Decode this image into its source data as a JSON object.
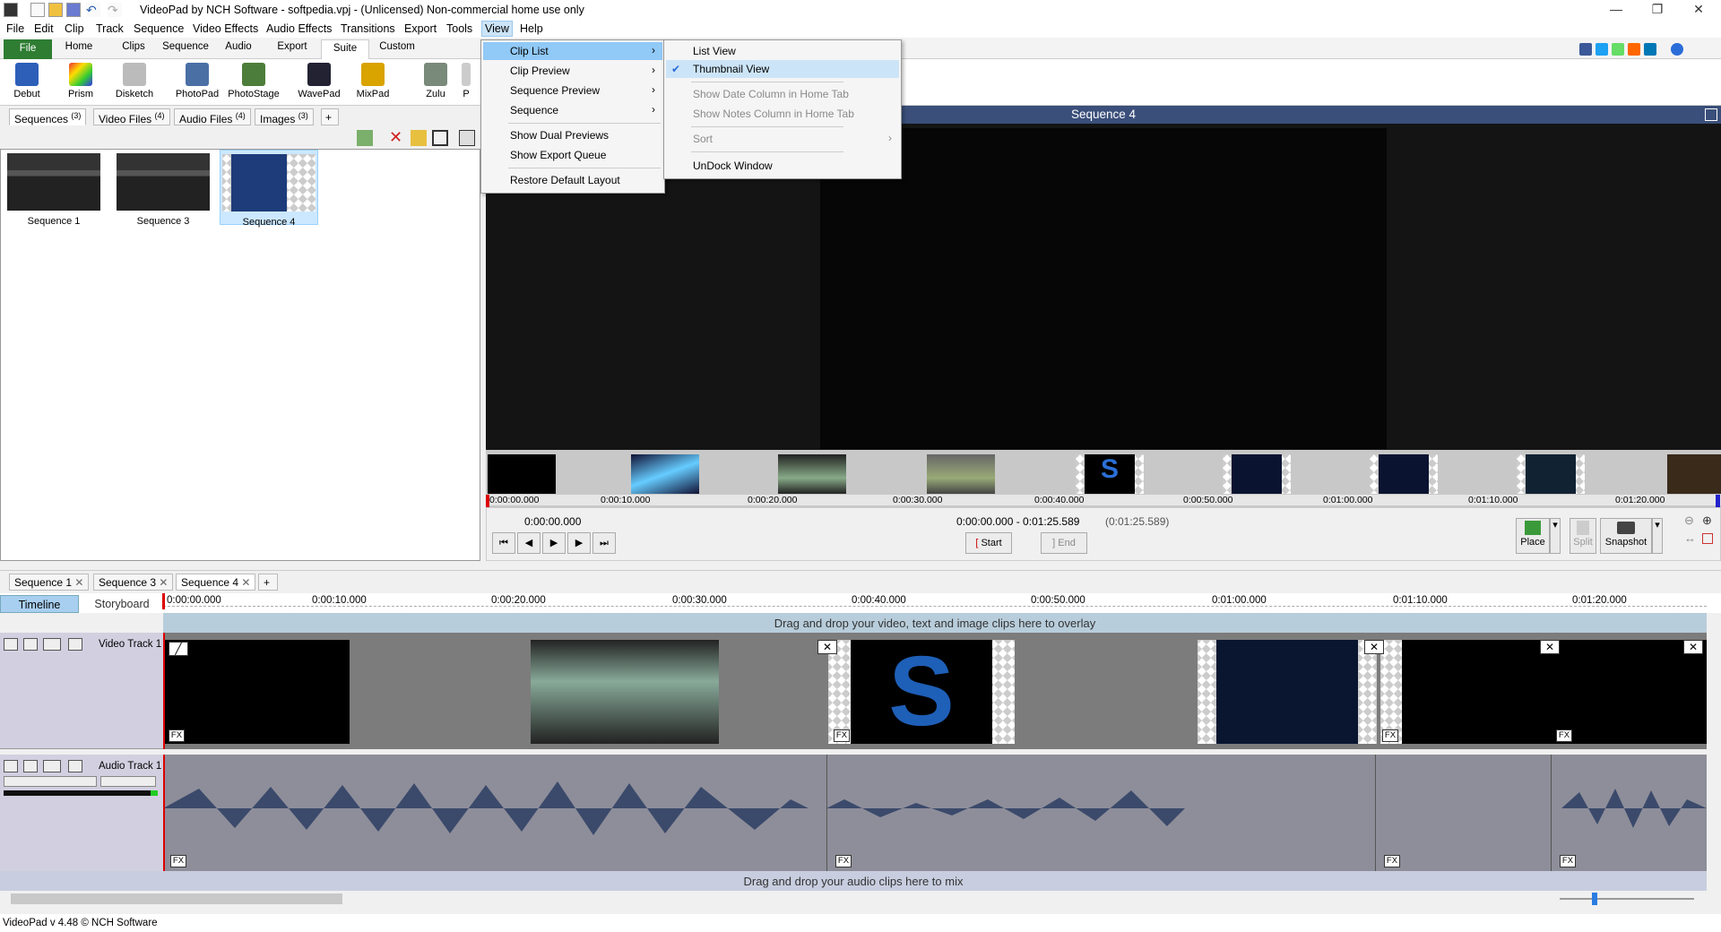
{
  "titlebar": {
    "title": "VideoPad by NCH Software - softpedia.vpj - (Unlicensed) Non-commercial home use only",
    "min": "—",
    "max": "❐",
    "close": "✕"
  },
  "menubar": [
    "File",
    "Edit",
    "Clip",
    "Track",
    "Sequence",
    "Video Effects",
    "Audio Effects",
    "Transitions",
    "Export",
    "Tools",
    "View",
    "Help"
  ],
  "ribbon_tabs": [
    "File",
    "Home",
    "Clips",
    "Sequence",
    "Audio",
    "Export",
    "Suite",
    "Custom"
  ],
  "ribbon_buttons": [
    "Debut",
    "Prism",
    "Disketch",
    "PhotoPad",
    "PhotoStage",
    "WavePad",
    "MixPad",
    "Zulu",
    "P"
  ],
  "bin_tabs": [
    {
      "label": "Sequences",
      "count": "(3)"
    },
    {
      "label": "Video Files",
      "count": "(4)"
    },
    {
      "label": "Audio Files",
      "count": "(4)"
    },
    {
      "label": "Images",
      "count": "(3)"
    },
    {
      "label": "+",
      "count": ""
    }
  ],
  "bin_items": [
    "Sequence 1",
    "Sequence 3",
    "Sequence 4"
  ],
  "preview": {
    "title": "Sequence 4"
  },
  "filmstrip_times": [
    "0:00:00.000",
    "0:00:10.000",
    "0:00:20.000",
    "0:00:30.000",
    "0:00:40.000",
    "0:00:50.000",
    "0:01:00.000",
    "0:01:10.000",
    "0:01:20.000"
  ],
  "transport": {
    "position": "0:00:00.000",
    "range": "0:00:00.000 - 0:01:25.589",
    "duration": "(0:01:25.589)",
    "start": "Start",
    "end": "End",
    "place": "Place",
    "split": "Split",
    "snapshot": "Snapshot"
  },
  "seq_tabs": [
    "Sequence 1",
    "Sequence 3",
    "Sequence 4",
    "+"
  ],
  "timeline": {
    "timeline_btn": "Timeline",
    "storyboard_btn": "Storyboard",
    "ticks": [
      "0:00:00.000",
      "0:00:10.000",
      "0:00:20.000",
      "0:00:30.000",
      "0:00:40.000",
      "0:00:50.000",
      "0:01:00.000",
      "0:01:10.000",
      "0:01:20.000"
    ],
    "overlay_text": "Drag and drop your video, text and image clips here to overlay",
    "video_track": "Video Track 1",
    "audio_track": "Audio Track 1",
    "audio_drop": "Drag and drop your audio clips here to mix",
    "fx": "FX"
  },
  "view_menu": {
    "items": [
      "Clip List",
      "Clip Preview",
      "Sequence Preview",
      "Sequence",
      "Show Dual Previews",
      "Show Export Queue",
      "Restore Default Layout"
    ],
    "arrow": "›"
  },
  "clip_list_submenu": {
    "items": [
      "List View",
      "Thumbnail View",
      "Show Date Column in Home Tab",
      "Show Notes Column in Home Tab",
      "Sort",
      "UnDock Window"
    ],
    "check": "✔"
  },
  "status": "VideoPad v 4.48 © NCH Software",
  "colors": {
    "accent": "#2e7d32",
    "preview_header": "#3a4f7a",
    "selection": "#91c9f7",
    "waveform": "#3b4a6b"
  }
}
